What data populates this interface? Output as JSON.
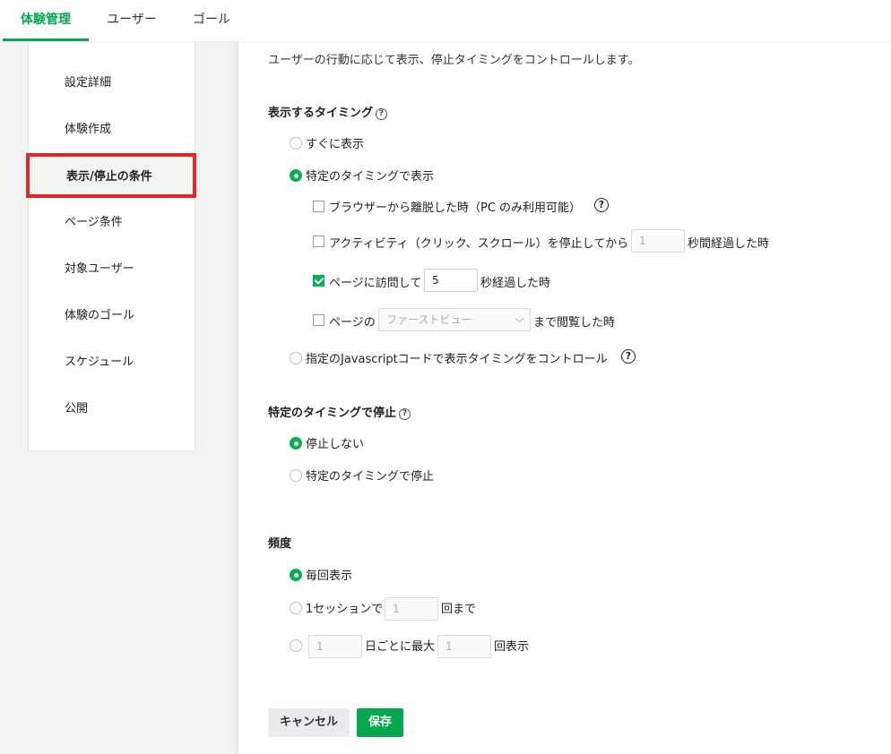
{
  "tabs": [
    {
      "label": "体験管理",
      "active": true
    },
    {
      "label": "ユーザー",
      "active": false
    },
    {
      "label": "ゴール",
      "active": false
    }
  ],
  "sidebar": {
    "items": [
      {
        "label": "設定詳細"
      },
      {
        "label": "体験作成"
      },
      {
        "label": "表示/停止の条件",
        "active": true
      },
      {
        "label": "ページ条件"
      },
      {
        "label": "対象ユーザー"
      },
      {
        "label": "体験のゴール"
      },
      {
        "label": "スケジュール"
      },
      {
        "label": "公開"
      }
    ]
  },
  "main": {
    "description": "ユーザーの行動に応じて表示、停止タイミングをコントロールします。",
    "display_timing": {
      "title": "表示するタイミング",
      "help_icon": "question-circle-icon",
      "immediate": "すぐに表示",
      "specific": "特定のタイミングで表示",
      "browser_exit": "ブラウザーから離脱した時（PC のみ利用可能）",
      "activity_prefix": "アクティビティ（クリック、スクロール）を停止してから",
      "activity_value": "1",
      "activity_suffix": "秒間経過した時",
      "visit_prefix": "ページに訪問して",
      "visit_value": "5",
      "visit_suffix": "秒経過した時",
      "scroll_prefix": "ページの",
      "scroll_select": "ファーストビュー",
      "scroll_suffix": "まで閲覧した時",
      "js_control": "指定のJavascriptコードで表示タイミングをコントロール"
    },
    "stop_timing": {
      "title": "特定のタイミングで停止",
      "no_stop": "停止しない",
      "specific_stop": "特定のタイミングで停止"
    },
    "frequency": {
      "title": "頻度",
      "every_time": "毎回表示",
      "session_value": "1",
      "session_label_a": "1セッションで",
      "session_label_b": "回まで",
      "days_value": "1",
      "days_label": "日ごとに最大",
      "max_value": "1",
      "times_label": "回表示"
    },
    "buttons": {
      "cancel": "キャンセル",
      "save": "保存"
    }
  },
  "colors": {
    "accent": "#06a74f",
    "highlight_border": "#e5252b"
  }
}
